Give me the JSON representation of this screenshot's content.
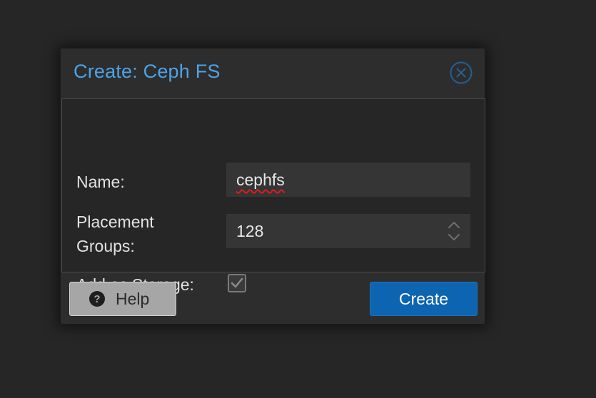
{
  "dialog": {
    "title": "Create: Ceph FS",
    "close_icon": "close-circle-icon"
  },
  "form": {
    "name": {
      "label": "Name:",
      "value": "cephfs"
    },
    "placement_groups": {
      "label_line1": "Placement",
      "label_line2": "Groups:",
      "value": "128",
      "spinner_icon": "up-down-chevron-icon"
    },
    "add_as_storage": {
      "label": "Add as Storage:",
      "checked": true
    }
  },
  "footer": {
    "help_label": "Help",
    "help_icon": "question-circle-icon",
    "create_label": "Create"
  },
  "colors": {
    "title": "#4da3e6",
    "primary_button": "#0d64b0",
    "help_button": "#a6a6a6",
    "background": "#262626",
    "input_bg": "#353535"
  }
}
